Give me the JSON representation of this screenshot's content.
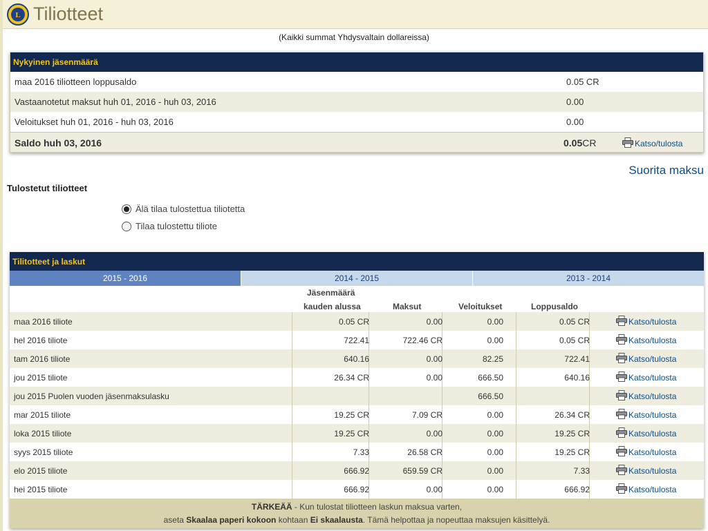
{
  "header": {
    "title": "Tiliotteet"
  },
  "currency_note": "(Kaikki summat Yhdysvaltain dollareissa)",
  "summary": {
    "heading": "Nykyinen jäsenmäärä",
    "rows": [
      {
        "label": "maa 2016 tiliotteen loppusaldo",
        "value": "0.05 CR"
      },
      {
        "label": "Vastaanotetut maksut huh 01, 2016 - huh 03, 2016",
        "value": "0.00"
      },
      {
        "label": "Veloitukset huh 01, 2016 - huh 03, 2016",
        "value": "0.00"
      }
    ],
    "total": {
      "label": "Saldo huh 03, 2016",
      "amount": "0.05",
      "unit": "CR",
      "link": "Katso/tulosta"
    }
  },
  "pay_link": "Suorita maksu",
  "printed": {
    "title": "Tulostetut tiliotteet",
    "options": [
      {
        "label": "Älä tilaa tulostettua tiliotetta",
        "selected": true
      },
      {
        "label": "Tilaa tulostettu tiliote",
        "selected": false
      }
    ]
  },
  "statements": {
    "heading": "Tilitotteet ja laskut",
    "tabs": [
      {
        "label": "2015 - 2016",
        "active": true
      },
      {
        "label": "2014 - 2015",
        "active": false
      },
      {
        "label": "2013 - 2014",
        "active": false
      }
    ],
    "columns": {
      "start_line1": "Jäsenmäärä",
      "start_line2": "kauden alussa",
      "payments": "Maksut",
      "charges": "Veloitukset",
      "end": "Loppusaldo"
    },
    "rows": [
      {
        "desc": "maa 2016 tiliote",
        "start": "0.05 CR",
        "pay": "0.00",
        "chg": "0.00",
        "end": "0.05 CR",
        "link": "Katso/tulosta"
      },
      {
        "desc": "hel 2016 tiliote",
        "start": "722.41",
        "pay": "722.46 CR",
        "chg": "0.00",
        "end": "0.05 CR",
        "link": "Katso/tulosta"
      },
      {
        "desc": "tam 2016 tiliote",
        "start": "640.16",
        "pay": "0.00",
        "chg": "82.25",
        "end": "722.41",
        "link": "Katso/tulosta"
      },
      {
        "desc": "jou 2015 tiliote",
        "start": "26.34 CR",
        "pay": "0.00",
        "chg": "666.50",
        "end": "640.16",
        "link": "Katso/tulosta"
      },
      {
        "desc": "jou 2015 Puolen vuoden jäsenmaksulasku",
        "start": "",
        "pay": "",
        "chg": "666.50",
        "end": "",
        "link": "Katso/tulosta"
      },
      {
        "desc": "mar 2015 tiliote",
        "start": "19.25 CR",
        "pay": "7.09 CR",
        "chg": "0.00",
        "end": "26.34 CR",
        "link": "Katso/tulosta"
      },
      {
        "desc": "loka 2015 tiliote",
        "start": "19.25 CR",
        "pay": "0.00",
        "chg": "0.00",
        "end": "19.25 CR",
        "link": "Katso/tulosta"
      },
      {
        "desc": "syys 2015 tiliote",
        "start": "7.33",
        "pay": "26.58 CR",
        "chg": "0.00",
        "end": "19.25 CR",
        "link": "Katso/tulosta"
      },
      {
        "desc": "elo 2015 tiliote",
        "start": "666.92",
        "pay": "659.59 CR",
        "chg": "0.00",
        "end": "7.33",
        "link": "Katso/tulosta"
      },
      {
        "desc": "hei 2015 tiliote",
        "start": "666.92",
        "pay": "0.00",
        "chg": "0.00",
        "end": "666.92",
        "link": "Katso/tulosta"
      }
    ],
    "footer": {
      "important": "TÄRKEÄÄ",
      "line1_rest": " - Kun tulostat tiliotteen laskun maksua varten,",
      "line2_a": "aseta ",
      "line2_b": "Skaalaa paperi kokoon",
      "line2_c": " kohtaan ",
      "line2_d": "Ei skaalausta",
      "line2_e": ". Tämä helpottaa ja nopeuttaa maksujen käsittelyä."
    }
  },
  "colors": {
    "header_bg": "#f4f1d8",
    "box_header_bg": "#13284f",
    "box_header_text": "#f2c318",
    "active_tab": "#5f83c0",
    "inactive_tab": "#c6d9ea",
    "link": "#0a4d8c"
  },
  "icons": {
    "logo": "lions-emblem",
    "print": "printer-icon"
  }
}
